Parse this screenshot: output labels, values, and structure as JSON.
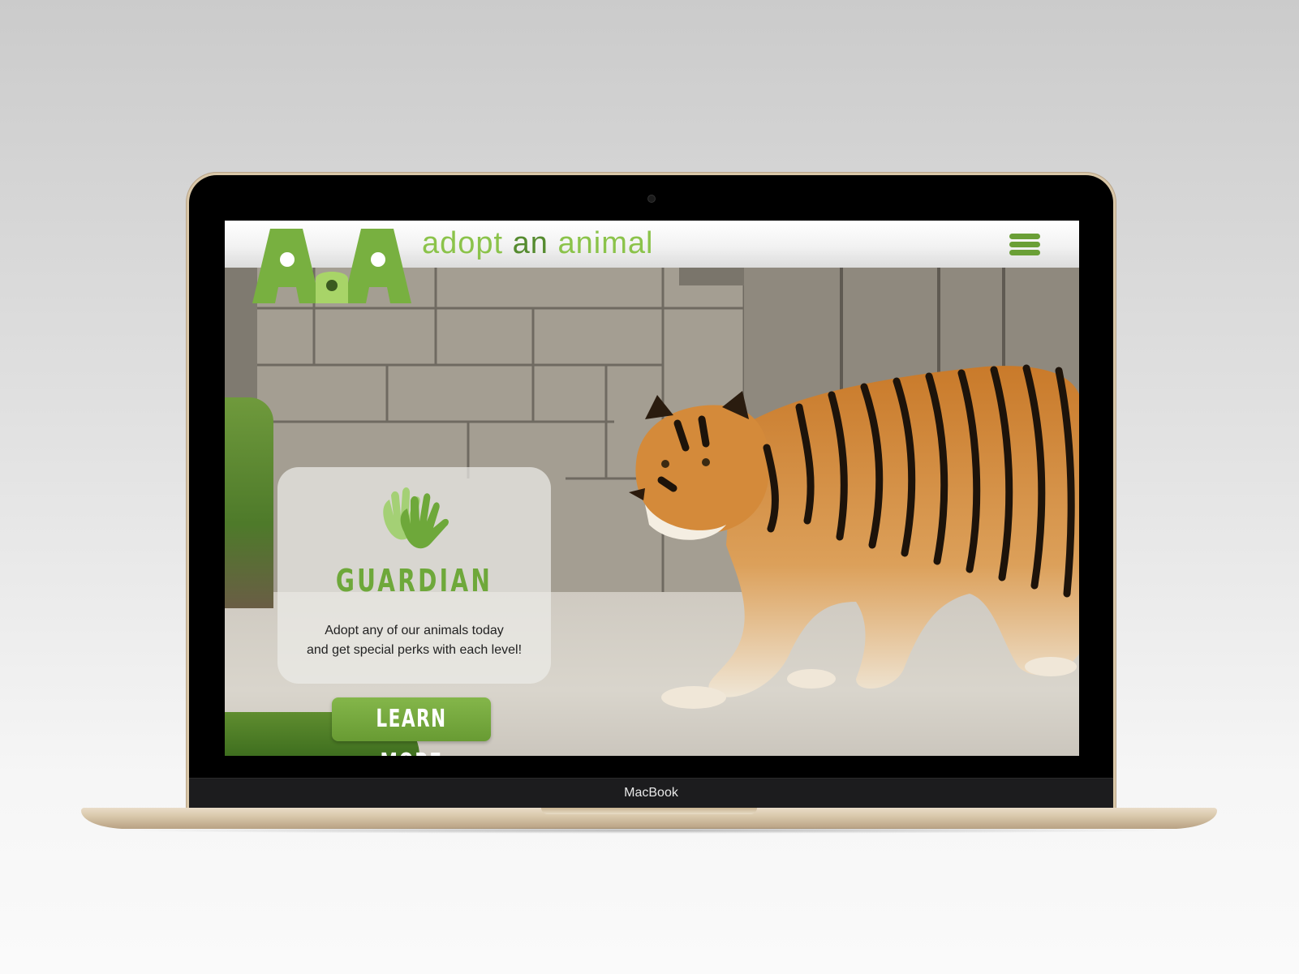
{
  "device": {
    "label": "MacBook"
  },
  "site": {
    "logo_text": "AaA",
    "brand_part1": "adopt ",
    "brand_part2": "an",
    "brand_part3": " animal",
    "menu_icon": "hamburger-menu-icon"
  },
  "hero": {
    "card_icon": "handprints-icon",
    "card_title": "GUARDIAN",
    "card_text_line1": "Adopt any of our animals today",
    "card_text_line2": "and get special perks with each level!",
    "cta_label": "LEARN MORE"
  },
  "colors": {
    "brand_green": "#8bc34a",
    "dark_green": "#558b2f",
    "button_green": "#6f9f38",
    "laptop_gold": "#d9c8ab"
  }
}
